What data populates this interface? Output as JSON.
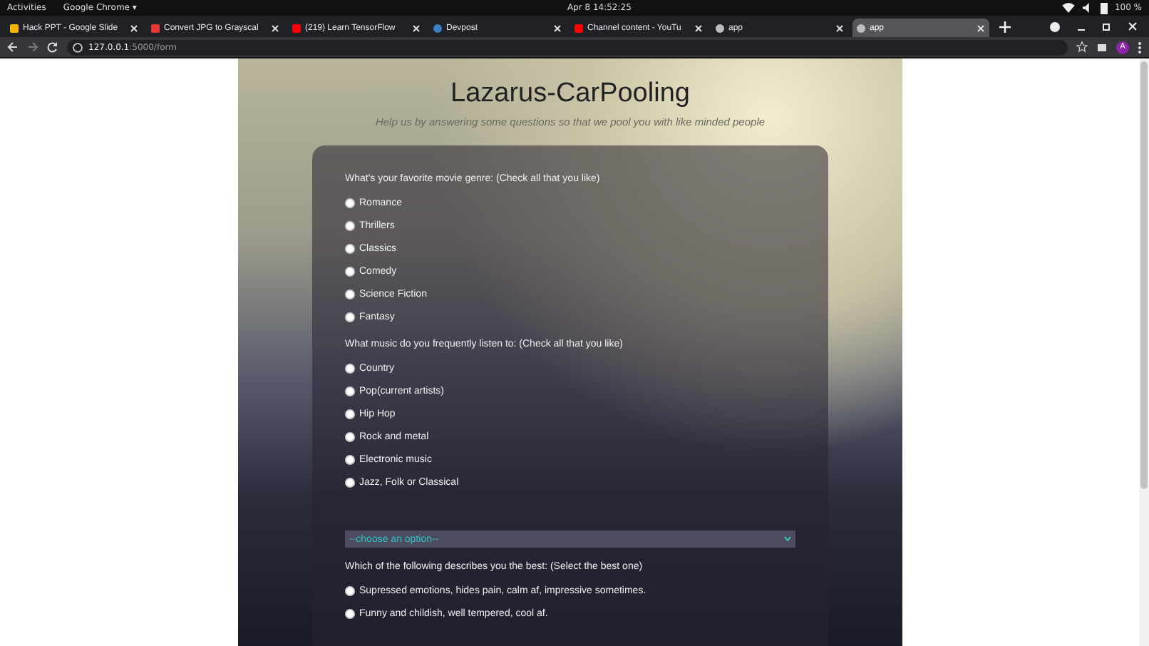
{
  "system_bar": {
    "activities": "Activities",
    "app": "Google Chrome ▾",
    "clock": "Apr 8  14:52:25",
    "battery": "100 %"
  },
  "tabs": [
    {
      "label": "Hack PPT - Google Slide",
      "selected": false
    },
    {
      "label": "Convert JPG to Grayscal",
      "selected": false
    },
    {
      "label": "(219) Learn TensorFlow",
      "selected": false
    },
    {
      "label": "Devpost",
      "selected": false
    },
    {
      "label": "Channel content - YouTu",
      "selected": false
    },
    {
      "label": "app",
      "selected": false
    },
    {
      "label": "app",
      "selected": true
    }
  ],
  "address_bar": {
    "host": "127.0.0.1",
    "path": ":5000/form",
    "profile": "A"
  },
  "page": {
    "title": "Lazarus-CarPooling",
    "subtitle": "Help us by answering some questions so that we pool you with like minded people"
  },
  "questions": [
    {
      "kind": "checks",
      "prompt": "What's your favorite movie genre: (Check all that you like)",
      "options": [
        {
          "label": "Romance",
          "checked": false
        },
        {
          "label": "Thrillers",
          "checked": false
        },
        {
          "label": "Classics",
          "checked": false
        },
        {
          "label": "Comedy",
          "checked": false
        },
        {
          "label": "Science Fiction",
          "checked": false
        },
        {
          "label": "Fantasy",
          "checked": false
        }
      ]
    },
    {
      "kind": "checks",
      "prompt": "What music do you frequently listen to: (Check all that you like)",
      "options": [
        {
          "label": "Country",
          "checked": false
        },
        {
          "label": "Pop(current artists)",
          "checked": false
        },
        {
          "label": "Hip Hop",
          "checked": false
        },
        {
          "label": "Rock and metal",
          "checked": false
        },
        {
          "label": "Electronic music",
          "checked": false
        },
        {
          "label": "Jazz, Folk or Classical",
          "checked": false
        }
      ]
    },
    {
      "kind": "select",
      "value": "--choose an option--"
    },
    {
      "kind": "radios",
      "prompt": "Which of the following describes you the best: (Select the best one)",
      "options": [
        {
          "label": "Supressed emotions, hides pain, calm af, impressive sometimes.",
          "selected": false
        },
        {
          "label": "Funny and childish, well tempered, cool af.",
          "selected": false
        }
      ]
    }
  ]
}
